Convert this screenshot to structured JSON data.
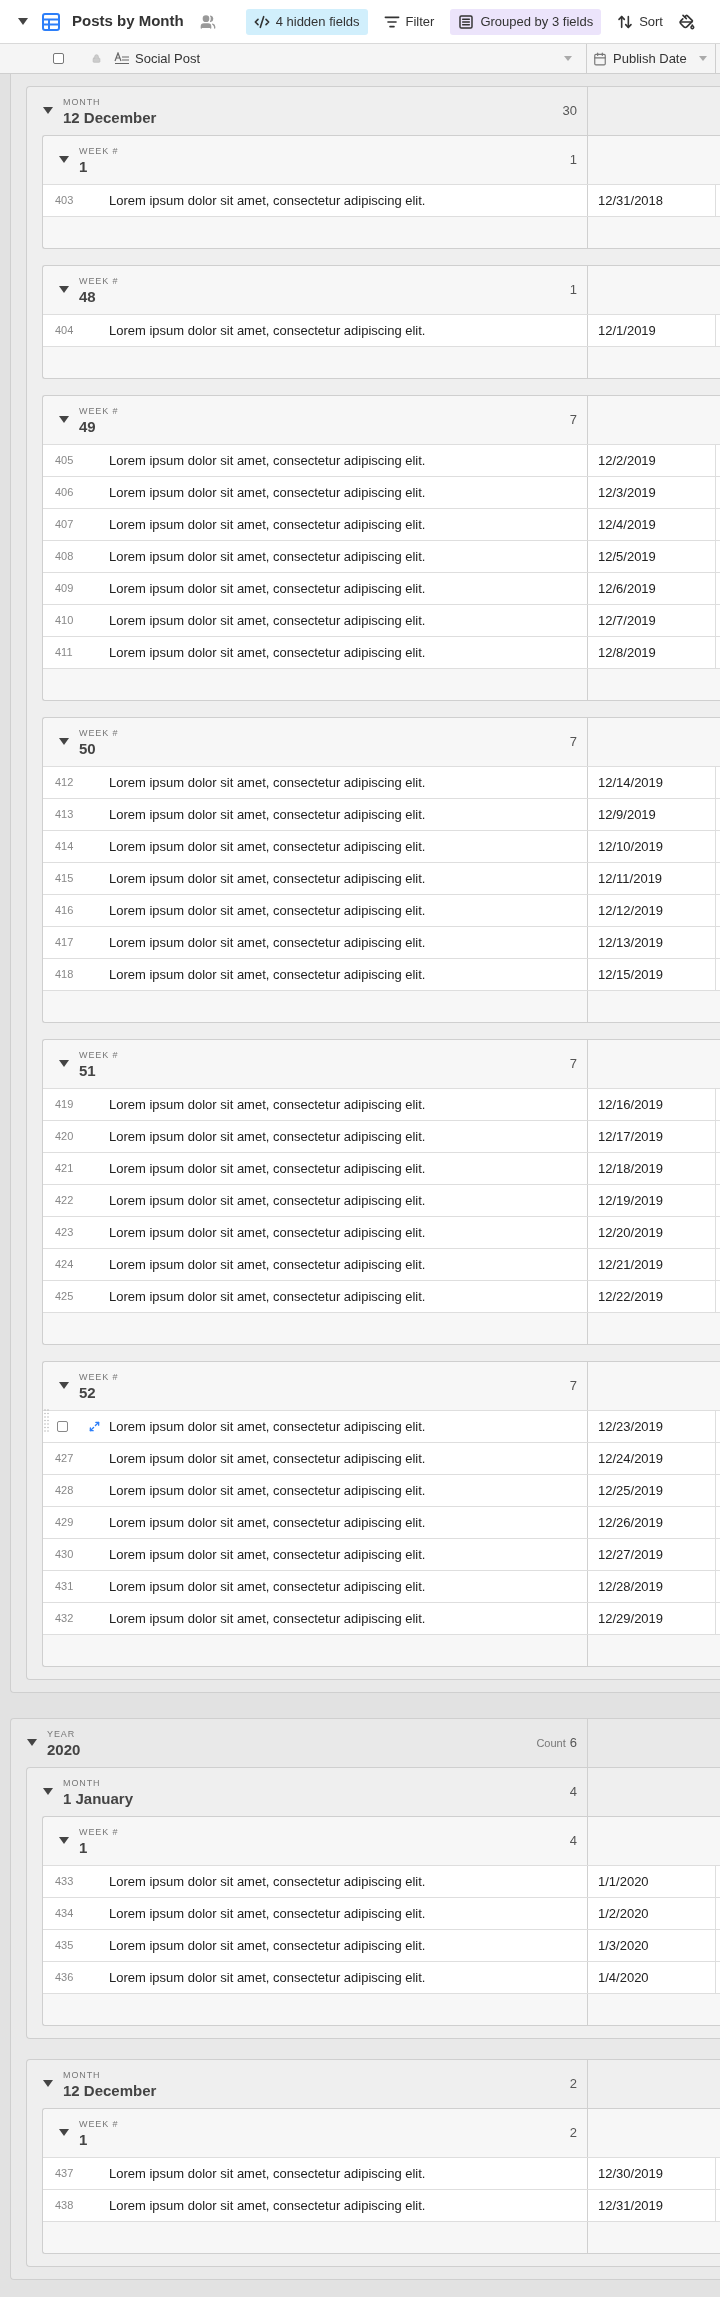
{
  "toolbar": {
    "view_name": "Posts by Month",
    "buttons": [
      {
        "kind": "hidden",
        "label": "4 hidden fields",
        "color": "#d1effc"
      },
      {
        "kind": "filter",
        "label": "Filter"
      },
      {
        "kind": "group",
        "label": "Grouped by 3 fields",
        "color": "#ece4fb"
      },
      {
        "kind": "sort",
        "label": "Sort"
      }
    ]
  },
  "columns": [
    {
      "kind": "text",
      "name": "Social Post"
    },
    {
      "kind": "date",
      "name": "Publish Date"
    }
  ],
  "select_all": {
    "checked": false
  },
  "groups": [
    {
      "months": [
        {
          "label": "MONTH",
          "value": "12 December",
          "count": "30",
          "expanded": true,
          "weeks": [
            {
              "label": "WEEK #",
              "value": "1",
              "count": "1",
              "expanded": true,
              "rows": [
                {
                  "number": "403",
                  "post": "Lorem ipsum dolor sit amet, consectetur adipiscing elit.",
                  "date": "12/31/2018",
                  "hovered": false
                }
              ]
            },
            {
              "label": "WEEK #",
              "value": "48",
              "count": "1",
              "expanded": true,
              "rows": [
                {
                  "number": "404",
                  "post": "Lorem ipsum dolor sit amet, consectetur adipiscing elit.",
                  "date": "12/1/2019",
                  "hovered": false
                }
              ]
            },
            {
              "label": "WEEK #",
              "value": "49",
              "count": "7",
              "expanded": true,
              "rows": [
                {
                  "number": "405",
                  "post": "Lorem ipsum dolor sit amet, consectetur adipiscing elit.",
                  "date": "12/2/2019",
                  "hovered": false
                },
                {
                  "number": "406",
                  "post": "Lorem ipsum dolor sit amet, consectetur adipiscing elit.",
                  "date": "12/3/2019",
                  "hovered": false
                },
                {
                  "number": "407",
                  "post": "Lorem ipsum dolor sit amet, consectetur adipiscing elit.",
                  "date": "12/4/2019",
                  "hovered": false
                },
                {
                  "number": "408",
                  "post": "Lorem ipsum dolor sit amet, consectetur adipiscing elit.",
                  "date": "12/5/2019",
                  "hovered": false
                },
                {
                  "number": "409",
                  "post": "Lorem ipsum dolor sit amet, consectetur adipiscing elit.",
                  "date": "12/6/2019",
                  "hovered": false
                },
                {
                  "number": "410",
                  "post": "Lorem ipsum dolor sit amet, consectetur adipiscing elit.",
                  "date": "12/7/2019",
                  "hovered": false
                },
                {
                  "number": "411",
                  "post": "Lorem ipsum dolor sit amet, consectetur adipiscing elit.",
                  "date": "12/8/2019",
                  "hovered": false
                }
              ]
            },
            {
              "label": "WEEK #",
              "value": "50",
              "count": "7",
              "expanded": true,
              "rows": [
                {
                  "number": "412",
                  "post": "Lorem ipsum dolor sit amet, consectetur adipiscing elit.",
                  "date": "12/14/2019",
                  "hovered": false
                },
                {
                  "number": "413",
                  "post": "Lorem ipsum dolor sit amet, consectetur adipiscing elit.",
                  "date": "12/9/2019",
                  "hovered": false
                },
                {
                  "number": "414",
                  "post": "Lorem ipsum dolor sit amet, consectetur adipiscing elit.",
                  "date": "12/10/2019",
                  "hovered": false
                },
                {
                  "number": "415",
                  "post": "Lorem ipsum dolor sit amet, consectetur adipiscing elit.",
                  "date": "12/11/2019",
                  "hovered": false
                },
                {
                  "number": "416",
                  "post": "Lorem ipsum dolor sit amet, consectetur adipiscing elit.",
                  "date": "12/12/2019",
                  "hovered": false
                },
                {
                  "number": "417",
                  "post": "Lorem ipsum dolor sit amet, consectetur adipiscing elit.",
                  "date": "12/13/2019",
                  "hovered": false
                },
                {
                  "number": "418",
                  "post": "Lorem ipsum dolor sit amet, consectetur adipiscing elit.",
                  "date": "12/15/2019",
                  "hovered": false
                }
              ]
            },
            {
              "label": "WEEK #",
              "value": "51",
              "count": "7",
              "expanded": true,
              "rows": [
                {
                  "number": "419",
                  "post": "Lorem ipsum dolor sit amet, consectetur adipiscing elit.",
                  "date": "12/16/2019",
                  "hovered": false
                },
                {
                  "number": "420",
                  "post": "Lorem ipsum dolor sit amet, consectetur adipiscing elit.",
                  "date": "12/17/2019",
                  "hovered": false
                },
                {
                  "number": "421",
                  "post": "Lorem ipsum dolor sit amet, consectetur adipiscing elit.",
                  "date": "12/18/2019",
                  "hovered": false
                },
                {
                  "number": "422",
                  "post": "Lorem ipsum dolor sit amet, consectetur adipiscing elit.",
                  "date": "12/19/2019",
                  "hovered": false
                },
                {
                  "number": "423",
                  "post": "Lorem ipsum dolor sit amet, consectetur adipiscing elit.",
                  "date": "12/20/2019",
                  "hovered": false
                },
                {
                  "number": "424",
                  "post": "Lorem ipsum dolor sit amet, consectetur adipiscing elit.",
                  "date": "12/21/2019",
                  "hovered": false
                },
                {
                  "number": "425",
                  "post": "Lorem ipsum dolor sit amet, consectetur adipiscing elit.",
                  "date": "12/22/2019",
                  "hovered": false
                }
              ]
            },
            {
              "label": "WEEK #",
              "value": "52",
              "count": "7",
              "expanded": true,
              "rows": [
                {
                  "post": "Lorem ipsum dolor sit amet, consectetur adipiscing elit.",
                  "date": "12/23/2019",
                  "hovered": true,
                  "checked": false
                },
                {
                  "number": "427",
                  "post": "Lorem ipsum dolor sit amet, consectetur adipiscing elit.",
                  "date": "12/24/2019",
                  "hovered": false
                },
                {
                  "number": "428",
                  "post": "Lorem ipsum dolor sit amet, consectetur adipiscing elit.",
                  "date": "12/25/2019",
                  "hovered": false
                },
                {
                  "number": "429",
                  "post": "Lorem ipsum dolor sit amet, consectetur adipiscing elit.",
                  "date": "12/26/2019",
                  "hovered": false
                },
                {
                  "number": "430",
                  "post": "Lorem ipsum dolor sit amet, consectetur adipiscing elit.",
                  "date": "12/27/2019",
                  "hovered": false
                },
                {
                  "number": "431",
                  "post": "Lorem ipsum dolor sit amet, consectetur adipiscing elit.",
                  "date": "12/28/2019",
                  "hovered": false
                },
                {
                  "number": "432",
                  "post": "Lorem ipsum dolor sit amet, consectetur adipiscing elit.",
                  "date": "12/29/2019",
                  "hovered": false
                }
              ]
            }
          ]
        }
      ]
    },
    {
      "label": "YEAR",
      "value": "2020",
      "count_label": "Count",
      "count": "6",
      "expanded": true,
      "months": [
        {
          "label": "MONTH",
          "value": "1 January",
          "count": "4",
          "expanded": true,
          "weeks": [
            {
              "label": "WEEK #",
              "value": "1",
              "count": "4",
              "expanded": true,
              "rows": [
                {
                  "number": "433",
                  "post": "Lorem ipsum dolor sit amet, consectetur adipiscing elit.",
                  "date": "1/1/2020",
                  "hovered": false
                },
                {
                  "number": "434",
                  "post": "Lorem ipsum dolor sit amet, consectetur adipiscing elit.",
                  "date": "1/2/2020",
                  "hovered": false
                },
                {
                  "number": "435",
                  "post": "Lorem ipsum dolor sit amet, consectetur adipiscing elit.",
                  "date": "1/3/2020",
                  "hovered": false
                },
                {
                  "number": "436",
                  "post": "Lorem ipsum dolor sit amet, consectetur adipiscing elit.",
                  "date": "1/4/2020",
                  "hovered": false
                }
              ]
            }
          ]
        },
        {
          "label": "MONTH",
          "value": "12 December",
          "count": "2",
          "expanded": true,
          "weeks": [
            {
              "label": "WEEK #",
              "value": "1",
              "count": "2",
              "expanded": true,
              "rows": [
                {
                  "number": "437",
                  "post": "Lorem ipsum dolor sit amet, consectetur adipiscing elit.",
                  "date": "12/30/2019",
                  "hovered": false
                },
                {
                  "number": "438",
                  "post": "Lorem ipsum dolor sit amet, consectetur adipiscing elit.",
                  "date": "12/31/2019",
                  "hovered": false
                }
              ]
            }
          ]
        }
      ]
    }
  ]
}
